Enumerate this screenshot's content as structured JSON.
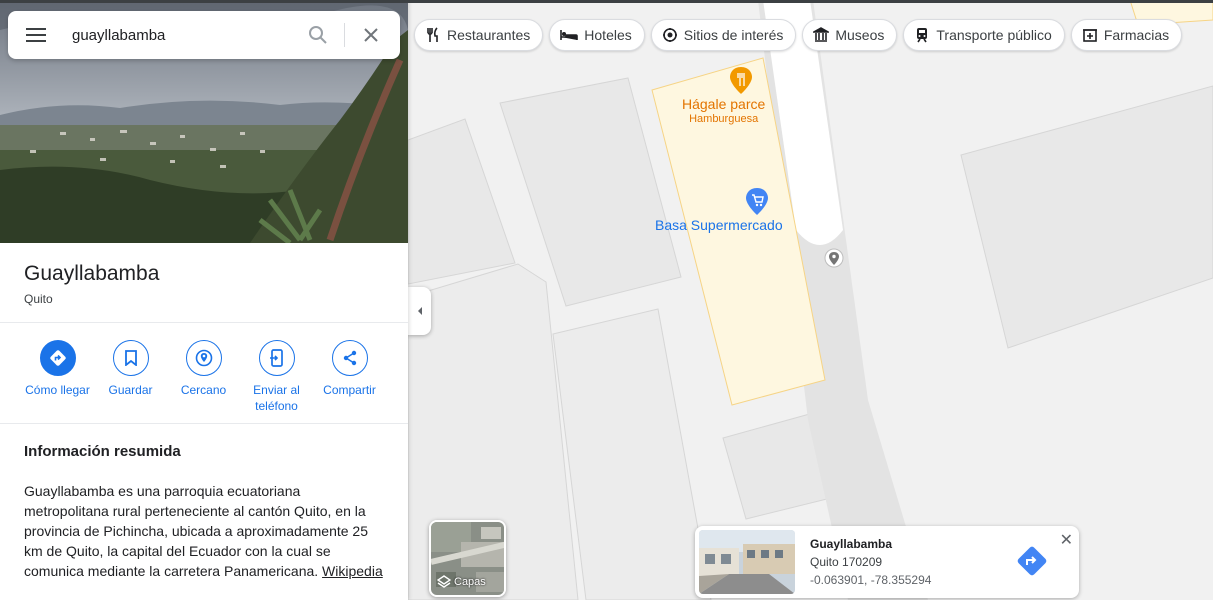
{
  "search": {
    "value": "guayllabamba"
  },
  "place": {
    "name": "Guayllabamba",
    "subtitle": "Quito",
    "actions": [
      {
        "label": "Cómo llegar"
      },
      {
        "label": "Guardar"
      },
      {
        "label": "Cercano"
      },
      {
        "label": "Enviar al teléfono"
      },
      {
        "label": "Compartir"
      }
    ],
    "summary_heading": "Información resumida",
    "summary_text": "Guayllabamba es una parroquia ecuatoriana metropolitana rural perteneciente al cantón Quito, en la provincia de Pichincha, ubicada a aproximadamente 25 km de Quito, la capital del Ecuador con la cual se comunica mediante la carretera Panamericana.",
    "summary_link": "Wikipedia"
  },
  "chips": [
    {
      "label": "Restaurantes",
      "icon": "fork-knife-icon"
    },
    {
      "label": "Hoteles",
      "icon": "bed-icon"
    },
    {
      "label": "Sitios de interés",
      "icon": "camera-icon"
    },
    {
      "label": "Museos",
      "icon": "museum-icon"
    },
    {
      "label": "Transporte público",
      "icon": "train-icon"
    },
    {
      "label": "Farmacias",
      "icon": "pharmacy-icon"
    }
  ],
  "map": {
    "poi_restaurant": {
      "name": "Hágale parce",
      "category": "Hamburguesa"
    },
    "poi_supermarket": {
      "name": "Basa Supermercado"
    },
    "layers_label": "Capas"
  },
  "card": {
    "title": "Guayllabamba",
    "line2": "Quito 170209",
    "coords": "-0.063901, -78.355294"
  },
  "colors": {
    "accent": "#1a73e8",
    "poi_orange": "#e37400",
    "zone_fill": "#fef7e0"
  }
}
